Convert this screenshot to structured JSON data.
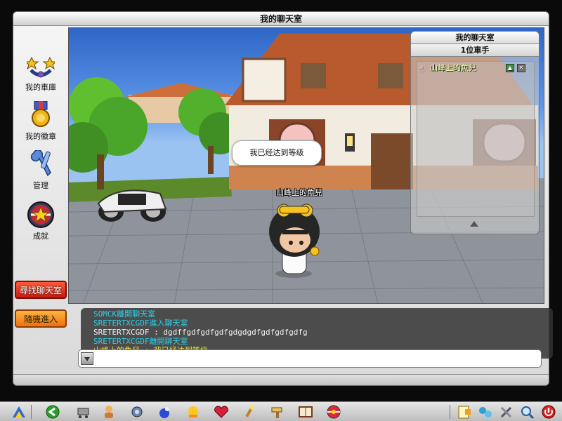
{
  "window": {
    "title": "我的聊天室"
  },
  "sidebar": {
    "items": [
      {
        "label": "我的車庫",
        "icon": "garage-icon"
      },
      {
        "label": "我的徽章",
        "icon": "medal-icon"
      },
      {
        "label": "管理",
        "icon": "tools-icon"
      },
      {
        "label": "成就",
        "icon": "achievement-icon"
      }
    ],
    "find_room_label": "尋找聊天室",
    "random_enter_label": "隨機進入"
  },
  "scene": {
    "speech_bubble": "我已经达到等级",
    "character_name": "山峰上的魚兒"
  },
  "rider_panel": {
    "title": "我的聊天室",
    "count_label": "1位車手",
    "riders": [
      {
        "name": "山峰上的魚兒"
      }
    ]
  },
  "chat": {
    "lines": [
      {
        "text": "SOMCK離開聊天室",
        "color": "#2ad0e8"
      },
      {
        "text": "SRETERTXCGDF進入聊天室",
        "color": "#2ad0e8"
      },
      {
        "text": "SRETERTXCGDF : dgdffgdfgdfgdfgdgdgdfgdfgdfgdfg",
        "color": "#f2f2f2"
      },
      {
        "text": "SRETERTXCGDF離開聊天室",
        "color": "#2ad0e8"
      },
      {
        "text": "山峰上的魚兒 : 我已经达到等级",
        "color": "#f6e830"
      }
    ],
    "input_value": ""
  },
  "taskbar": {
    "icons": [
      "start-logo-icon",
      "back-arrow-icon",
      "shop-cart-icon",
      "character-icon",
      "gear-icon",
      "bomb-icon",
      "duck-icon",
      "heart-icon",
      "wand-icon",
      "hammer-icon",
      "book-icon",
      "kart-ball-icon",
      "notes-icon",
      "network-icon",
      "settings-tools-icon",
      "magnifier-icon",
      "power-icon"
    ]
  }
}
